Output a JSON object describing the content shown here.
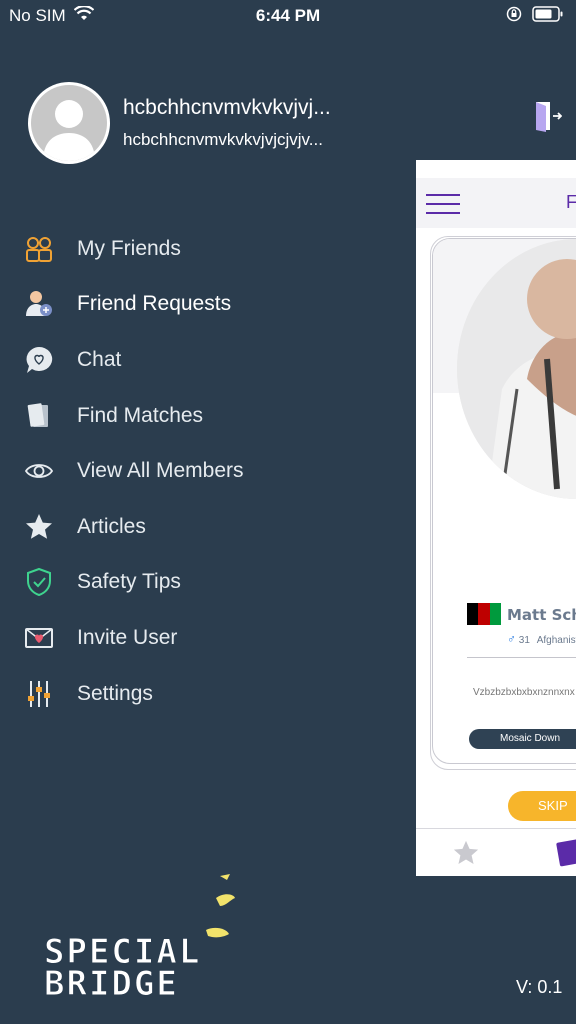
{
  "status": {
    "carrier": "No SIM",
    "time": "6:44 PM"
  },
  "profile": {
    "name": "hcbchhcnvmvkvkvjvj...",
    "email": "hcbchhcnvmvkvkvjvjcjvjv..."
  },
  "menu": [
    {
      "label": "My Friends",
      "icon": "friends-icon"
    },
    {
      "label": "Friend Requests",
      "icon": "friend-request-icon"
    },
    {
      "label": "Chat",
      "icon": "chat-icon"
    },
    {
      "label": "Find Matches",
      "icon": "cards-icon"
    },
    {
      "label": "View All Members",
      "icon": "eye-icon"
    },
    {
      "label": "Articles",
      "icon": "star-icon"
    },
    {
      "label": "Safety Tips",
      "icon": "shield-icon"
    },
    {
      "label": "Invite User",
      "icon": "envelope-heart-icon"
    },
    {
      "label": "Settings",
      "icon": "sliders-icon"
    }
  ],
  "logo": {
    "line1": "SPECIAL",
    "line2": "BRIDGE"
  },
  "version": "V: 0.1",
  "main": {
    "header_title": "F",
    "match": {
      "name": "Matt Schofi",
      "age": "31",
      "country": "Afghanista",
      "bio": "Vzbzbzbxbxbxnznnxnx",
      "chip": "Mosaic Down",
      "skip": "SKIP"
    }
  },
  "colors": {
    "background": "#2b3d4e",
    "accent": "#5b2ba8",
    "skip": "#f7b52b",
    "icon_orange": "#f0a234",
    "icon_green": "#3ed38e"
  }
}
